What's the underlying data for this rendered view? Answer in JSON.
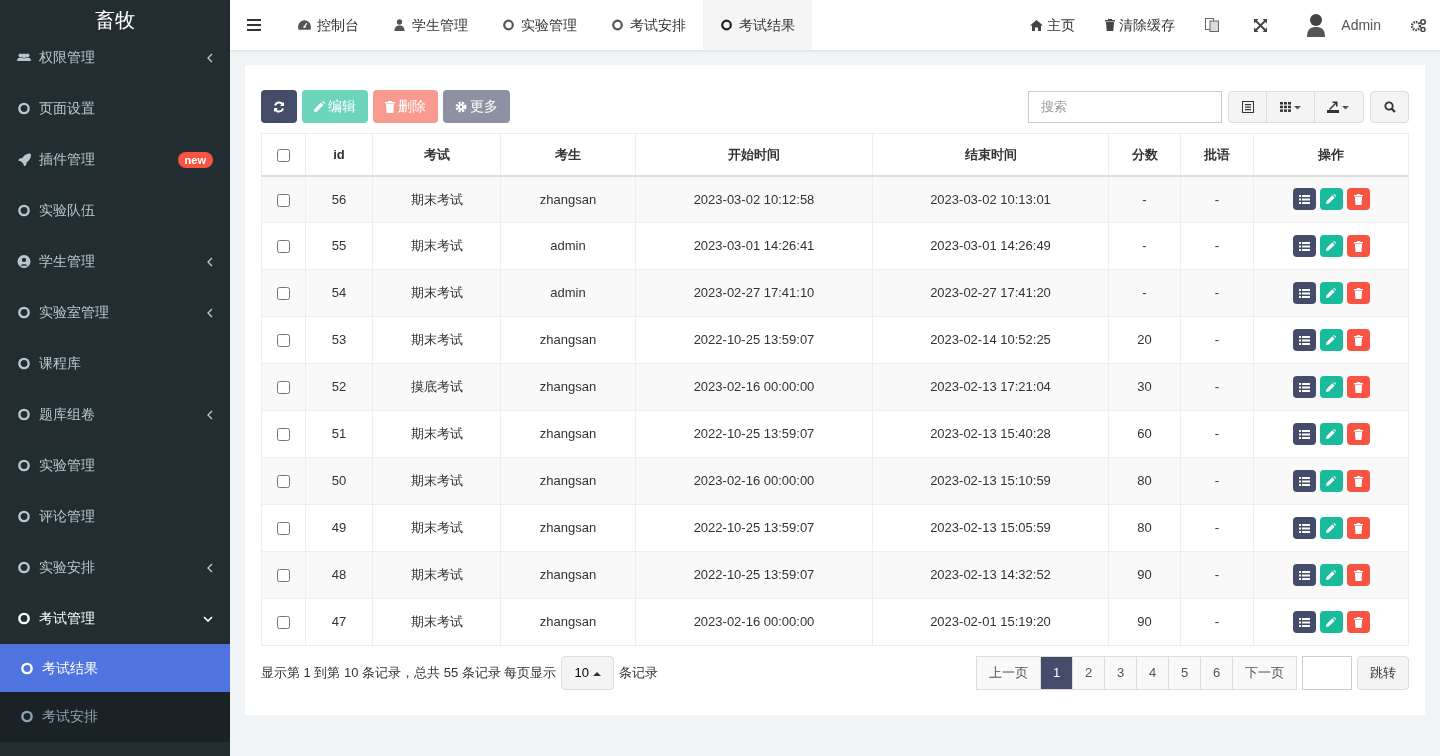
{
  "sidebar": {
    "logo": "畜牧",
    "items": [
      {
        "label": "权限管理",
        "kind": "group",
        "expanded": false,
        "selected": false
      },
      {
        "label": "页面设置",
        "kind": "link",
        "selected": false
      },
      {
        "label": "插件管理",
        "kind": "link",
        "selected": false,
        "badge": "new"
      },
      {
        "label": "实验队伍",
        "kind": "link",
        "selected": false
      },
      {
        "label": "学生管理",
        "kind": "group",
        "expanded": false,
        "selected": false
      },
      {
        "label": "实验室管理",
        "kind": "group",
        "expanded": false,
        "selected": false
      },
      {
        "label": "课程库",
        "kind": "link",
        "selected": false
      },
      {
        "label": "题库组卷",
        "kind": "group",
        "expanded": false,
        "selected": false
      },
      {
        "label": "实验管理",
        "kind": "link",
        "selected": false
      },
      {
        "label": "评论管理",
        "kind": "link",
        "selected": false
      },
      {
        "label": "实验安排",
        "kind": "group",
        "expanded": false,
        "selected": false
      },
      {
        "label": "考试管理",
        "kind": "group",
        "expanded": true,
        "selected": true,
        "children": [
          {
            "label": "考试结果",
            "selected": true
          },
          {
            "label": "考试安排",
            "selected": false
          }
        ]
      }
    ]
  },
  "tabs": [
    {
      "label": "控制台",
      "selected": false
    },
    {
      "label": "学生管理",
      "selected": false
    },
    {
      "label": "实验管理",
      "selected": false
    },
    {
      "label": "考试安排",
      "selected": false
    },
    {
      "label": "考试结果",
      "selected": true
    }
  ],
  "header_right": {
    "home": "主页",
    "clear_cache": "清除缓存",
    "user": "Admin"
  },
  "toolbar": {
    "buttons": [
      {
        "kind": "refresh",
        "disabled": false
      },
      {
        "kind": "edit",
        "label": "编辑",
        "disabled": true
      },
      {
        "kind": "delete",
        "label": "删除",
        "disabled": true
      },
      {
        "kind": "more",
        "label": "更多",
        "disabled": true
      }
    ],
    "search": {
      "placeholder": "搜索"
    }
  },
  "table": {
    "select_all_checked": false,
    "columns": [
      "id",
      "考试",
      "考生",
      "开始时间",
      "结束时间",
      "分数",
      "批语",
      "操作"
    ],
    "rows": [
      {
        "checked": false,
        "cells": [
          "56",
          "期末考试",
          "zhangsan",
          "2023-03-02 10:12:58",
          "2023-03-02 10:13:01",
          "-",
          "-"
        ]
      },
      {
        "checked": false,
        "cells": [
          "55",
          "期末考试",
          "admin",
          "2023-03-01 14:26:41",
          "2023-03-01 14:26:49",
          "-",
          "-"
        ]
      },
      {
        "checked": false,
        "cells": [
          "54",
          "期末考试",
          "admin",
          "2023-02-27 17:41:10",
          "2023-02-27 17:41:20",
          "-",
          "-"
        ]
      },
      {
        "checked": false,
        "cells": [
          "53",
          "期末考试",
          "zhangsan",
          "2022-10-25 13:59:07",
          "2023-02-14 10:52:25",
          "20",
          "-"
        ]
      },
      {
        "checked": false,
        "cells": [
          "52",
          "摸底考试",
          "zhangsan",
          "2023-02-16 00:00:00",
          "2023-02-13 17:21:04",
          "30",
          "-"
        ]
      },
      {
        "checked": false,
        "cells": [
          "51",
          "期末考试",
          "zhangsan",
          "2022-10-25 13:59:07",
          "2023-02-13 15:40:28",
          "60",
          "-"
        ]
      },
      {
        "checked": false,
        "cells": [
          "50",
          "期末考试",
          "zhangsan",
          "2023-02-16 00:00:00",
          "2023-02-13 15:10:59",
          "80",
          "-"
        ]
      },
      {
        "checked": false,
        "cells": [
          "49",
          "期末考试",
          "zhangsan",
          "2022-10-25 13:59:07",
          "2023-02-13 15:05:59",
          "80",
          "-"
        ]
      },
      {
        "checked": false,
        "cells": [
          "48",
          "期末考试",
          "zhangsan",
          "2022-10-25 13:59:07",
          "2023-02-13 14:32:52",
          "90",
          "-"
        ]
      },
      {
        "checked": false,
        "cells": [
          "47",
          "期末考试",
          "zhangsan",
          "2023-02-16 00:00:00",
          "2023-02-01 15:19:20",
          "90",
          "-"
        ]
      }
    ]
  },
  "pagination": {
    "info": "显示第 1 到第 10 条记录，总共 55 条记录 每页显示",
    "page_size": "10",
    "suffix": "条记录",
    "pages": [
      {
        "label": "上一页",
        "selected": false
      },
      {
        "label": "1",
        "selected": true
      },
      {
        "label": "2",
        "selected": false
      },
      {
        "label": "3",
        "selected": false
      },
      {
        "label": "4",
        "selected": false
      },
      {
        "label": "5",
        "selected": false
      },
      {
        "label": "6",
        "selected": false
      },
      {
        "label": "下一页",
        "selected": false
      }
    ],
    "jump": "跳转"
  }
}
